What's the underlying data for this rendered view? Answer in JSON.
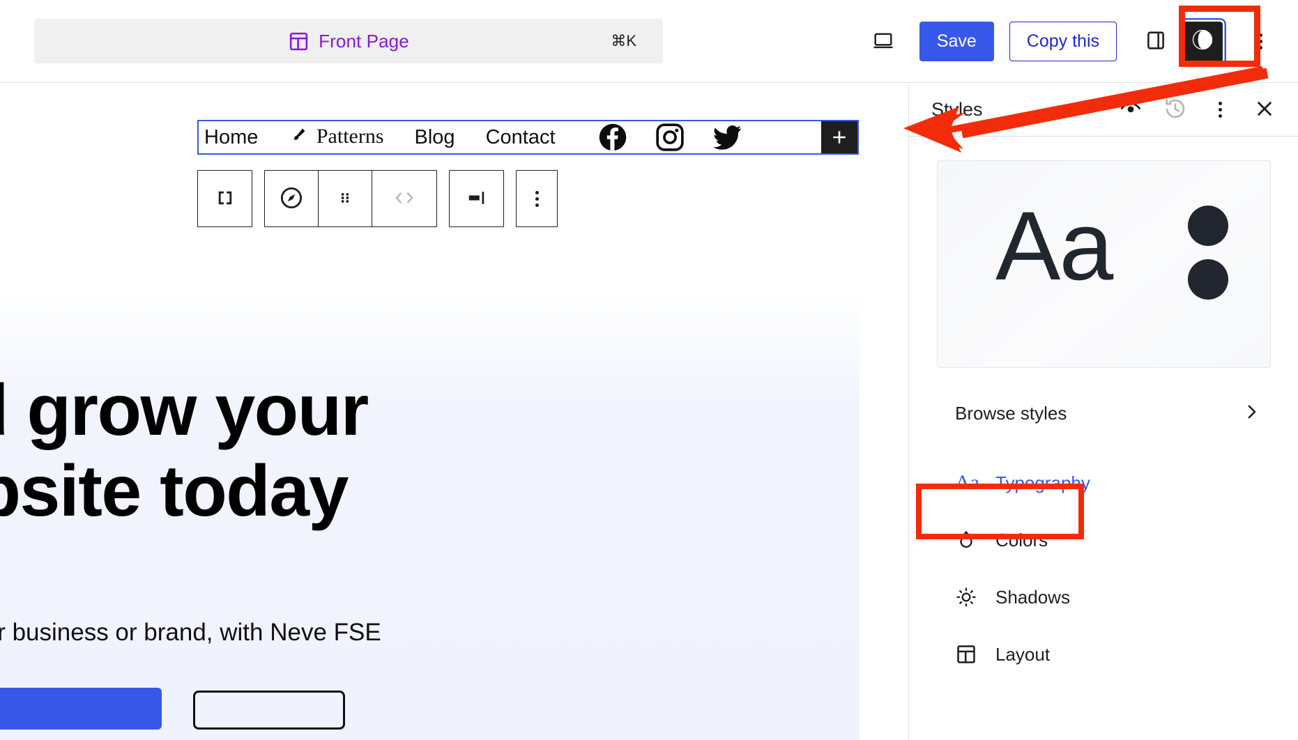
{
  "topbar": {
    "command_palette": {
      "icon": "template-page-icon",
      "label": "Front Page",
      "shortcut": "⌘K",
      "accent_color": "#8b18d6"
    },
    "device_preview_icon": "desktop-icon",
    "save_label": "Save",
    "save_color": "#3858e9",
    "copy_label": "Copy this",
    "copy_color": "#2222dd",
    "sidebar_toggle_icon": "settings-sidebar-icon",
    "styles_icon": "styles-contrast-icon",
    "more_icon": "three-dots-vertical-icon"
  },
  "annotations": {
    "styles_button_box_color": "#f22c0b",
    "typography_box_color": "#f22c0b",
    "arrow_color": "#f22c0b"
  },
  "canvas": {
    "navigation": {
      "items": [
        {
          "label": "Home",
          "style": "sans"
        },
        {
          "label": "Patterns",
          "style": "serif",
          "icon": "brush-icon"
        },
        {
          "label": "Blog",
          "style": "sans"
        },
        {
          "label": "Contact",
          "style": "sans"
        }
      ],
      "social_icons": [
        "facebook-icon",
        "instagram-icon",
        "twitter-icon"
      ],
      "appender_label": "+"
    },
    "block_toolbar": {
      "groups": [
        {
          "buttons": [
            {
              "icon": "block-navigation-icon"
            }
          ]
        },
        {
          "buttons": [
            {
              "icon": "change-block-type-icon"
            },
            {
              "icon": "drag-handle-icon"
            },
            {
              "icon": "move-left-right-icon",
              "disabled": true
            }
          ]
        },
        {
          "buttons": [
            {
              "icon": "justify-items-icon"
            }
          ]
        },
        {
          "buttons": [
            {
              "icon": "options-three-dots-icon"
            }
          ]
        }
      ]
    },
    "hero": {
      "heading_line1": "e and grow your",
      "heading_line2": "e website today",
      "subheading": "e for your business or brand, with Neve FSE"
    }
  },
  "sidebar": {
    "title": "Styles",
    "header_actions": [
      {
        "icon": "style-book-eye-icon",
        "disabled": false
      },
      {
        "icon": "revisions-history-icon",
        "disabled": true
      },
      {
        "icon": "three-dots-vertical-icon",
        "disabled": false
      },
      {
        "icon": "close-x-icon",
        "disabled": false
      }
    ],
    "preview_card": {
      "sample_text": "Aa",
      "palette_dots": [
        "#22262e",
        "#22262e"
      ]
    },
    "browse_styles": {
      "label": "Browse styles",
      "icon": "chevron-right-icon"
    },
    "items": [
      {
        "label": "Typography",
        "icon": "aa-typography-icon",
        "highlighted": true
      },
      {
        "label": "Colors",
        "icon": "droplet-icon",
        "highlighted": false
      },
      {
        "label": "Shadows",
        "icon": "sun-shadow-icon",
        "highlighted": false
      },
      {
        "label": "Layout",
        "icon": "layout-grid-icon",
        "highlighted": false
      }
    ]
  }
}
